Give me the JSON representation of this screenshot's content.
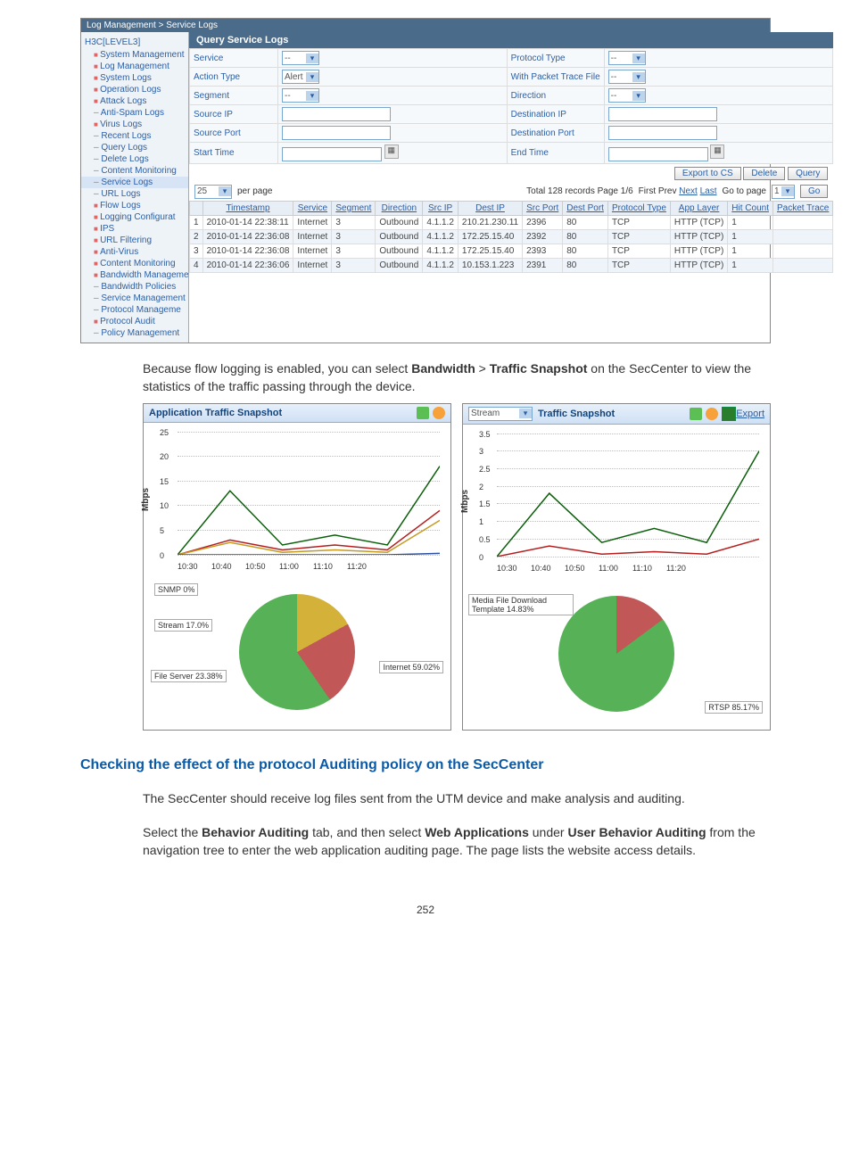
{
  "breadcrumb": "Log Management > Service Logs",
  "sidebar": {
    "root": "H3C[LEVEL3]",
    "items": [
      {
        "label": "System Management",
        "cls": "folder"
      },
      {
        "label": "Log Management",
        "cls": "folder"
      },
      {
        "label": "System Logs",
        "cls": "folder"
      },
      {
        "label": "Operation Logs",
        "cls": "folder"
      },
      {
        "label": "Attack Logs",
        "cls": "folder"
      },
      {
        "label": "Anti-Spam Logs",
        "cls": "leaf"
      },
      {
        "label": "Virus Logs",
        "cls": "folder"
      },
      {
        "label": "Recent Logs",
        "cls": "leaf"
      },
      {
        "label": "Query Logs",
        "cls": "leaf"
      },
      {
        "label": "Delete Logs",
        "cls": "leaf"
      },
      {
        "label": "Content Monitoring",
        "cls": "leaf"
      },
      {
        "label": "Service Logs",
        "cls": "leaf",
        "sel": true
      },
      {
        "label": "URL Logs",
        "cls": "leaf"
      },
      {
        "label": "Flow Logs",
        "cls": "folder"
      },
      {
        "label": "Logging Configurat",
        "cls": "folder"
      },
      {
        "label": "IPS",
        "cls": "folder"
      },
      {
        "label": "URL Filtering",
        "cls": "folder"
      },
      {
        "label": "Anti-Virus",
        "cls": "folder"
      },
      {
        "label": "Content Monitoring",
        "cls": "folder"
      },
      {
        "label": "Bandwidth Manageme",
        "cls": "folder"
      },
      {
        "label": "Bandwidth Policies",
        "cls": "leaf"
      },
      {
        "label": "Service Management",
        "cls": "leaf"
      },
      {
        "label": "Protocol Manageme",
        "cls": "leaf"
      },
      {
        "label": "Protocol Audit",
        "cls": "folder"
      },
      {
        "label": "Policy Management",
        "cls": "leaf"
      }
    ]
  },
  "query": {
    "title": "Query Service Logs",
    "filters": {
      "service_lbl": "Service",
      "service_val": "--",
      "protocol_type_lbl": "Protocol Type",
      "protocol_type_val": "--",
      "action_type_lbl": "Action Type",
      "action_type_val": "Alert",
      "trace_lbl": "With Packet Trace File",
      "trace_val": "--",
      "segment_lbl": "Segment",
      "segment_val": "--",
      "direction_lbl": "Direction",
      "direction_val": "--",
      "src_ip_lbl": "Source IP",
      "dst_ip_lbl": "Destination IP",
      "src_port_lbl": "Source Port",
      "dst_port_lbl": "Destination Port",
      "start_time_lbl": "Start Time",
      "end_time_lbl": "End Time"
    },
    "buttons": {
      "export": "Export to CS",
      "delete": "Delete",
      "query": "Query"
    },
    "perpage": "25",
    "perpage_suffix": "per page",
    "records": "Total 128 records   Page 1/6",
    "nav": {
      "first": "First",
      "prev": "Prev",
      "next": "Next",
      "last": "Last"
    },
    "goto_lbl": "Go to page",
    "goto_val": "1",
    "go_btn": "Go",
    "columns": [
      "",
      "Timestamp",
      "Service",
      "Segment",
      "Direction",
      "Src IP",
      "Dest IP",
      "Src Port",
      "Dest Port",
      "Protocol Type",
      "App Layer",
      "Hit Count",
      "Packet Trace"
    ],
    "rows": [
      {
        "n": "1",
        "ts": "2010-01-14 22:38:11",
        "svc": "Internet",
        "seg": "3",
        "dir": "Outbound",
        "sip": "4.1.1.2",
        "dip": "210.21.230.11",
        "sp": "2396",
        "dp": "80",
        "pt": "TCP",
        "al": "HTTP (TCP)",
        "hc": "1",
        "tr": ""
      },
      {
        "n": "2",
        "ts": "2010-01-14 22:36:08",
        "svc": "Internet",
        "seg": "3",
        "dir": "Outbound",
        "sip": "4.1.1.2",
        "dip": "172.25.15.40",
        "sp": "2392",
        "dp": "80",
        "pt": "TCP",
        "al": "HTTP (TCP)",
        "hc": "1",
        "tr": ""
      },
      {
        "n": "3",
        "ts": "2010-01-14 22:36:08",
        "svc": "Internet",
        "seg": "3",
        "dir": "Outbound",
        "sip": "4.1.1.2",
        "dip": "172.25.15.40",
        "sp": "2393",
        "dp": "80",
        "pt": "TCP",
        "al": "HTTP (TCP)",
        "hc": "1",
        "tr": ""
      },
      {
        "n": "4",
        "ts": "2010-01-14 22:36:06",
        "svc": "Internet",
        "seg": "3",
        "dir": "Outbound",
        "sip": "4.1.1.2",
        "dip": "10.153.1.223",
        "sp": "2391",
        "dp": "80",
        "pt": "TCP",
        "al": "HTTP (TCP)",
        "hc": "1",
        "tr": ""
      }
    ]
  },
  "body1_pre": "Because flow logging is enabled, you can select ",
  "body1_b1": "Bandwidth",
  "body1_mid": " > ",
  "body1_b2": "Traffic Snapshot",
  "body1_post": " on the SecCenter to view the statistics of the traffic passing through the device.",
  "panel_left": {
    "title": "Application Traffic Snapshot"
  },
  "panel_right": {
    "title": "Traffic Snapshot",
    "select": "Stream",
    "export": "Export"
  },
  "chart_data": [
    {
      "type": "line",
      "title": "Application Traffic Snapshot",
      "ylabel": "Mbps",
      "xlabel": "",
      "x": [
        "10:30",
        "10:40",
        "10:50",
        "11:00",
        "11:10",
        "11:20"
      ],
      "ylim": [
        0,
        25
      ],
      "yticks": [
        0,
        5,
        10,
        15,
        20,
        25
      ],
      "series": [
        {
          "name": "Internet",
          "values": [
            0,
            13,
            2,
            4,
            2,
            18
          ],
          "color": "#0a5f0a"
        },
        {
          "name": "File Server",
          "values": [
            0,
            3,
            1,
            2,
            1,
            9
          ],
          "color": "#b51e1e"
        },
        {
          "name": "Stream",
          "values": [
            0,
            2.5,
            0.5,
            1,
            0.5,
            7
          ],
          "color": "#c59b22"
        },
        {
          "name": "SNMP",
          "values": [
            0,
            0,
            0,
            0,
            0,
            0.3
          ],
          "color": "#2a4fa0"
        }
      ],
      "pie": {
        "type": "pie",
        "labels": [
          "Internet",
          "File Server",
          "Stream",
          "SNMP"
        ],
        "values": [
          59.02,
          23.38,
          17.0,
          0.0
        ],
        "colors": [
          "#57b157",
          "#c25757",
          "#d4b23a",
          "#4c6fb8"
        ]
      }
    },
    {
      "type": "line",
      "title": "Stream Traffic Snapshot",
      "ylabel": "Mbps",
      "xlabel": "",
      "x": [
        "10:30",
        "10:40",
        "10:50",
        "11:00",
        "11:10",
        "11:20"
      ],
      "ylim": [
        0,
        3.5
      ],
      "yticks": [
        0,
        0.5,
        1,
        1.5,
        2,
        2.5,
        3,
        3.5
      ],
      "series": [
        {
          "name": "RTSP",
          "values": [
            0,
            1.8,
            0.4,
            0.8,
            0.4,
            3.0
          ],
          "color": "#0a5f0a"
        },
        {
          "name": "Media File Download Template",
          "values": [
            0,
            0.3,
            0.07,
            0.14,
            0.07,
            0.5
          ],
          "color": "#b51e1e"
        }
      ],
      "pie": {
        "type": "pie",
        "labels": [
          "RTSP",
          "Media File Download Template"
        ],
        "values": [
          85.17,
          14.83
        ],
        "colors": [
          "#57b157",
          "#c25757"
        ]
      }
    }
  ],
  "pie_labels_left": {
    "snmp": "SNMP 0%",
    "stream": "Stream 17.0%",
    "fileserver": "File Server 23.38%",
    "internet": "Internet 59.02%"
  },
  "pie_labels_right": {
    "media": "Media File Download Template 14.83%",
    "rtsp": "RTSP 85.17%"
  },
  "section_title": "Checking the effect of the protocol Auditing policy on the SecCenter",
  "p1": "The SecCenter should receive log files sent from the UTM device and make analysis and auditing.",
  "p2_pre": "Select the ",
  "p2_b1": "Behavior Auditing",
  "p2_mid1": " tab, and then select ",
  "p2_b2": "Web Applications",
  "p2_mid2": " under ",
  "p2_b3": "User Behavior Auditing",
  "p2_post": " from the navigation tree to enter the web application auditing page. The page lists the website access details.",
  "pagenum": "252"
}
